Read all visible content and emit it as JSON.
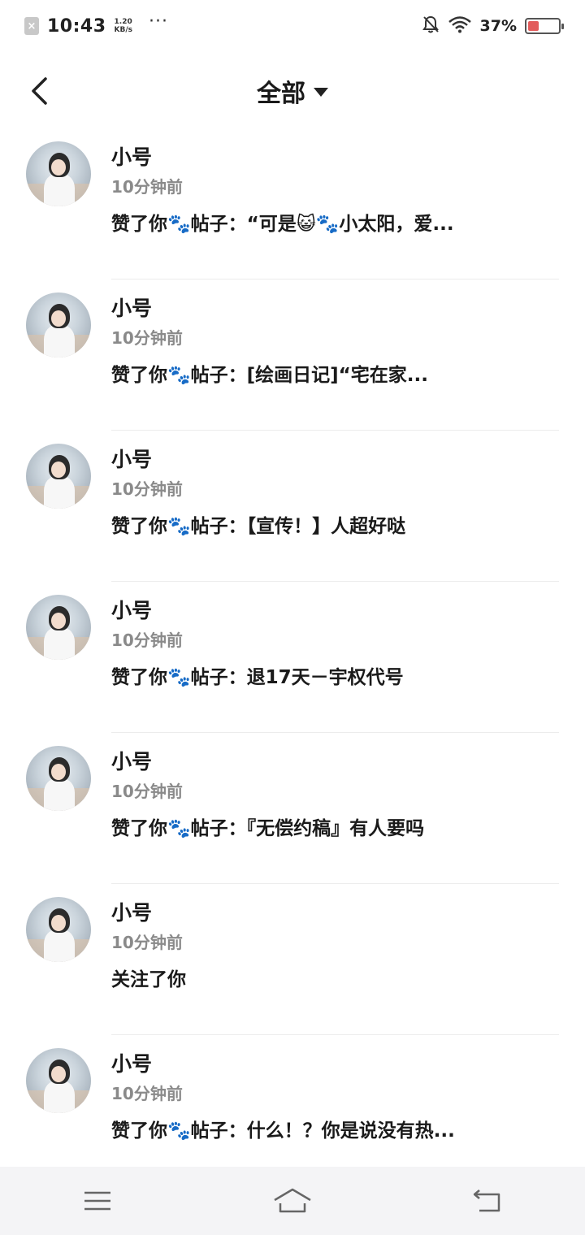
{
  "status_bar": {
    "time": "10:43",
    "speed_value": "1.20",
    "speed_unit": "KB/s",
    "overflow": "···",
    "battery_pct": "37%",
    "battery_level": 0.37,
    "battery_color": "#e25b5b"
  },
  "header": {
    "title": "全部"
  },
  "notifications": [
    {
      "name": "小号",
      "time": "10分钟前",
      "action": "赞了你🐾帖子：“可是😺🐾小太阳，爱..."
    },
    {
      "name": "小号",
      "time": "10分钟前",
      "action": "赞了你🐾帖子：[绘画日记]“宅在家..."
    },
    {
      "name": "小号",
      "time": "10分钟前",
      "action": "赞了你🐾帖子：【宣传！】人超好哒"
    },
    {
      "name": "小号",
      "time": "10分钟前",
      "action": "赞了你🐾帖子：退17天－宇权代号"
    },
    {
      "name": "小号",
      "time": "10分钟前",
      "action": "赞了你🐾帖子：『无偿约稿』有人要吗"
    },
    {
      "name": "小号",
      "time": "10分钟前",
      "action": "关注了你"
    },
    {
      "name": "小号",
      "time": "10分钟前",
      "action": "赞了你🐾帖子：什么！？你是说没有热..."
    }
  ],
  "icons": {
    "back": "chevron-left-icon",
    "menu": "menu-icon",
    "home": "home-icon",
    "return": "return-icon"
  }
}
